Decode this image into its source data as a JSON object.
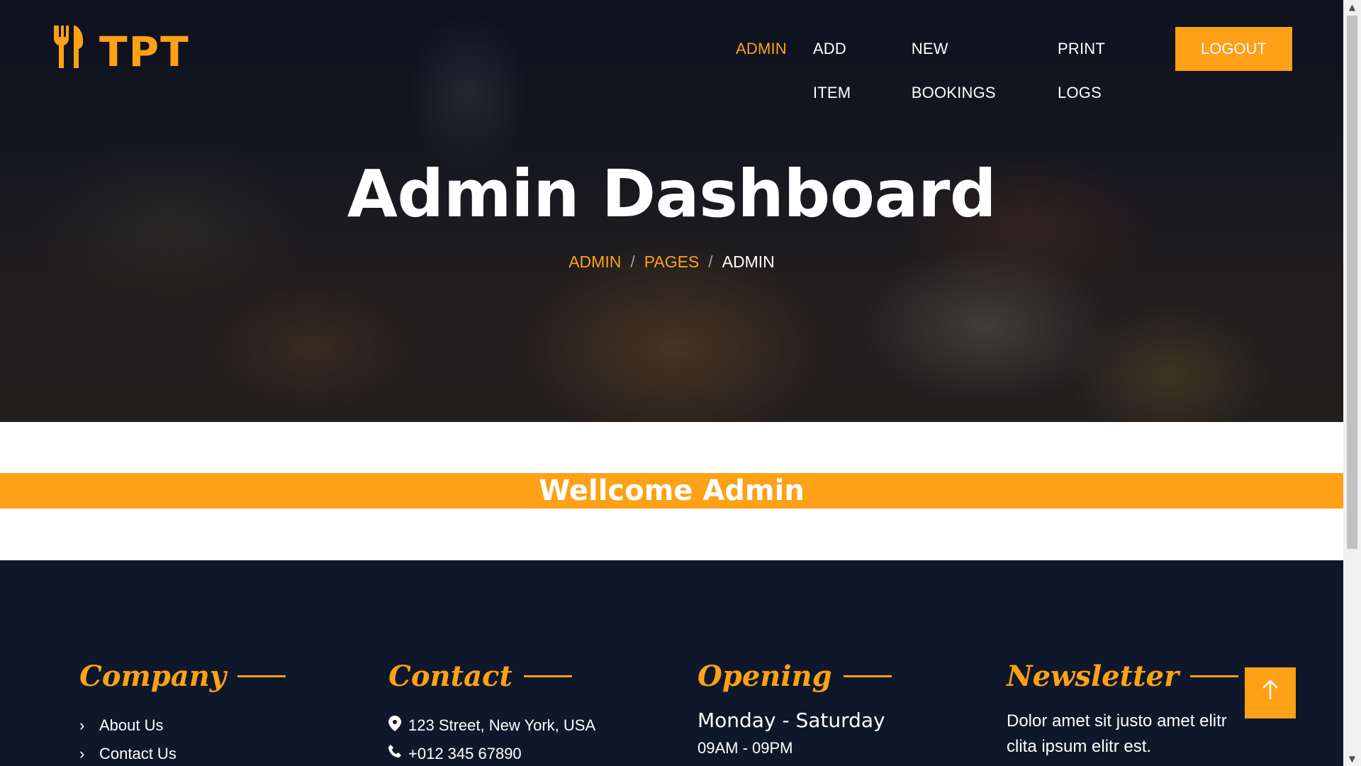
{
  "brand": {
    "name": "TPT",
    "accent": "#FEA116",
    "dark": "#0F172B"
  },
  "nav": {
    "items": [
      {
        "label": "ADMIN",
        "active": true
      },
      {
        "label": "ADD ITEM",
        "active": false
      },
      {
        "label": "NEW BOOKINGS",
        "active": false
      },
      {
        "label": "PRINT LOGS",
        "active": false
      }
    ],
    "logout_label": "LOGOUT"
  },
  "hero": {
    "title": "Admin Dashboard",
    "breadcrumb": {
      "items": [
        "ADMIN",
        "PAGES"
      ],
      "separator": "/",
      "current": "ADMIN"
    }
  },
  "welcome": {
    "text": "Wellcome Admin"
  },
  "footer": {
    "company": {
      "title": "Company",
      "links": [
        "About Us",
        "Contact Us"
      ]
    },
    "contact": {
      "title": "Contact",
      "address": "123 Street, New York, USA",
      "phone": "+012 345 67890"
    },
    "opening": {
      "title": "Opening",
      "days": "Monday - Saturday",
      "hours": "09AM - 09PM"
    },
    "newsletter": {
      "title": "Newsletter",
      "text": "Dolor amet sit justo amet elitr clita ipsum elitr est."
    }
  },
  "icons": {
    "logo": "utensils-icon",
    "chevron": "chevron-right-icon",
    "location": "map-marker-icon",
    "phone": "phone-icon",
    "back_to_top": "arrow-up-icon"
  }
}
